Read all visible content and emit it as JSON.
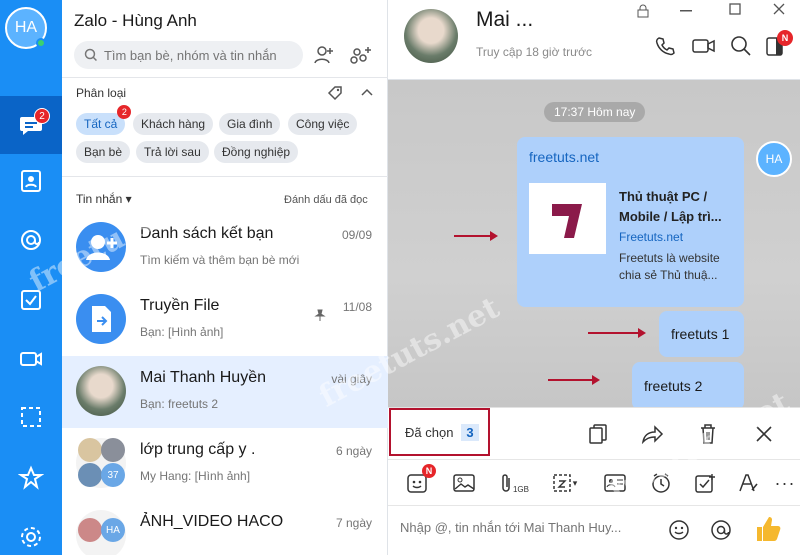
{
  "nav": {
    "avatar_initials": "HA",
    "messages_badge": "2"
  },
  "list": {
    "title": "Zalo - Hùng Anh",
    "search_placeholder": "Tìm bạn bè, nhóm và tin nhắn",
    "category_label": "Phân loại",
    "chips": [
      "Tất cả",
      "Khách hàng",
      "Gia đình",
      "Công việc",
      "Bạn bè",
      "Trả lời sau",
      "Đồng nghiệp"
    ],
    "chip_badge": "2",
    "messages_label": "Tin nhắn",
    "mark_read": "Đánh dấu đã đọc",
    "conversations": [
      {
        "name": "Danh sách kết bạn",
        "msg": "Tìm kiếm và thêm bạn bè mới",
        "time": "09/09"
      },
      {
        "name": "Truyền File",
        "msg": "Bạn: [Hình ảnh]",
        "time": "11/08"
      },
      {
        "name": "Mai Thanh Huyền",
        "msg": "Bạn: freetuts 2",
        "time": "vài giây"
      },
      {
        "name": "lớp trung cấp y .",
        "msg": "My Hang: [Hình ảnh]",
        "time": "6 ngày",
        "group_count": "37"
      },
      {
        "name": "ẢNH_VIDEO HACO",
        "msg": "",
        "time": "7 ngày",
        "avatar_initials": "HA"
      }
    ]
  },
  "chat": {
    "name": "Mai ...",
    "status": "Truy cập 18 giờ trước",
    "time_divider": "17:37 Hôm nay",
    "link": {
      "url": "freetuts.net",
      "title": "Thủ thuật PC / Mobile / Lập trì...",
      "domain": "Freetuts.net",
      "desc": "Freetuts là website chia sẻ Thủ thuậ..."
    },
    "msg_avatar": "HA",
    "msg1": "freetuts 1",
    "msg2": "freetuts 2",
    "selected_label": "Đã chọn",
    "selected_count": "3",
    "toolbar_badge": "N",
    "file_size_label": "1GB",
    "compose_placeholder": "Nhập @, tin nhắn tới Mai Thanh Huy...",
    "header_badge": "N"
  },
  "watermark": "freetuts.net"
}
